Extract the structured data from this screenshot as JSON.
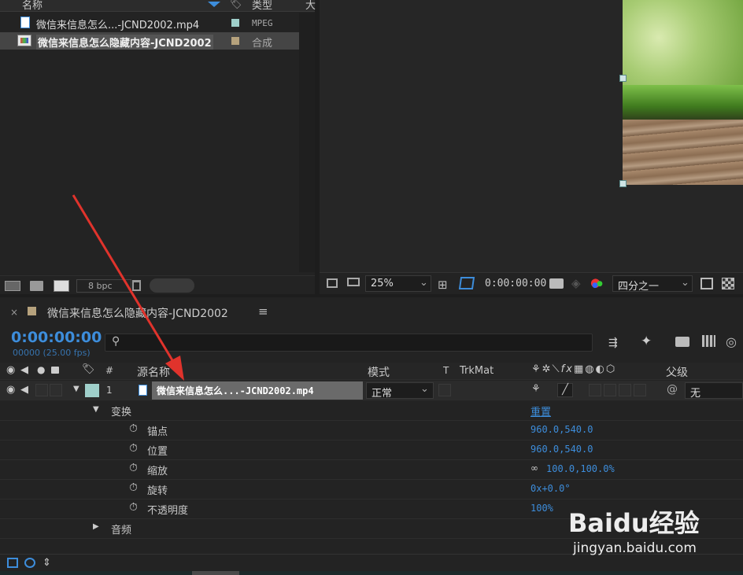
{
  "project": {
    "columns": {
      "name": "名称",
      "type": "类型",
      "size": "大"
    },
    "items": [
      {
        "name": "微信来信息怎么...-JCND2002.mp4",
        "type": "MPEG",
        "swatch": "#9fcfca",
        "selected": false
      },
      {
        "name": "微信来信息怎么隐藏内容-JCND2002",
        "type": "合成",
        "swatch": "#b6a27d",
        "selected": true
      }
    ],
    "bpc": "8 bpc"
  },
  "viewer": {
    "zoom": "25%",
    "timecode": "0:00:00:00",
    "resolution": "四分之一"
  },
  "timeline": {
    "tab_title": "微信来信息怎么隐藏内容-JCND2002",
    "current_time": "0:00:00:00",
    "frame_info": "00000 (25.00 fps)",
    "columns": {
      "num": "#",
      "source_name": "源名称",
      "mode": "模式",
      "t": "T",
      "trkmat": "TrkMat",
      "parent": "父级"
    },
    "layer": {
      "index": "1",
      "name": "微信来信息怎么...-JCND2002.mp4",
      "mode": "正常",
      "parent": "无"
    },
    "transform": {
      "label": "变换",
      "reset": "重置",
      "props": [
        {
          "name": "锚点",
          "value": "960.0,540.0"
        },
        {
          "name": "位置",
          "value": "960.0,540.0"
        },
        {
          "name": "缩放",
          "value": "100.0,100.0%"
        },
        {
          "name": "旋转",
          "value": "0x+0.0°"
        },
        {
          "name": "不透明度",
          "value": "100%"
        }
      ]
    },
    "audio_label": "音频"
  },
  "watermark": {
    "brand": "Baidu经验",
    "url": "jingyan.baidu.com"
  },
  "colors": {
    "accent": "#3d8ddb",
    "arrow": "#e0332c"
  }
}
